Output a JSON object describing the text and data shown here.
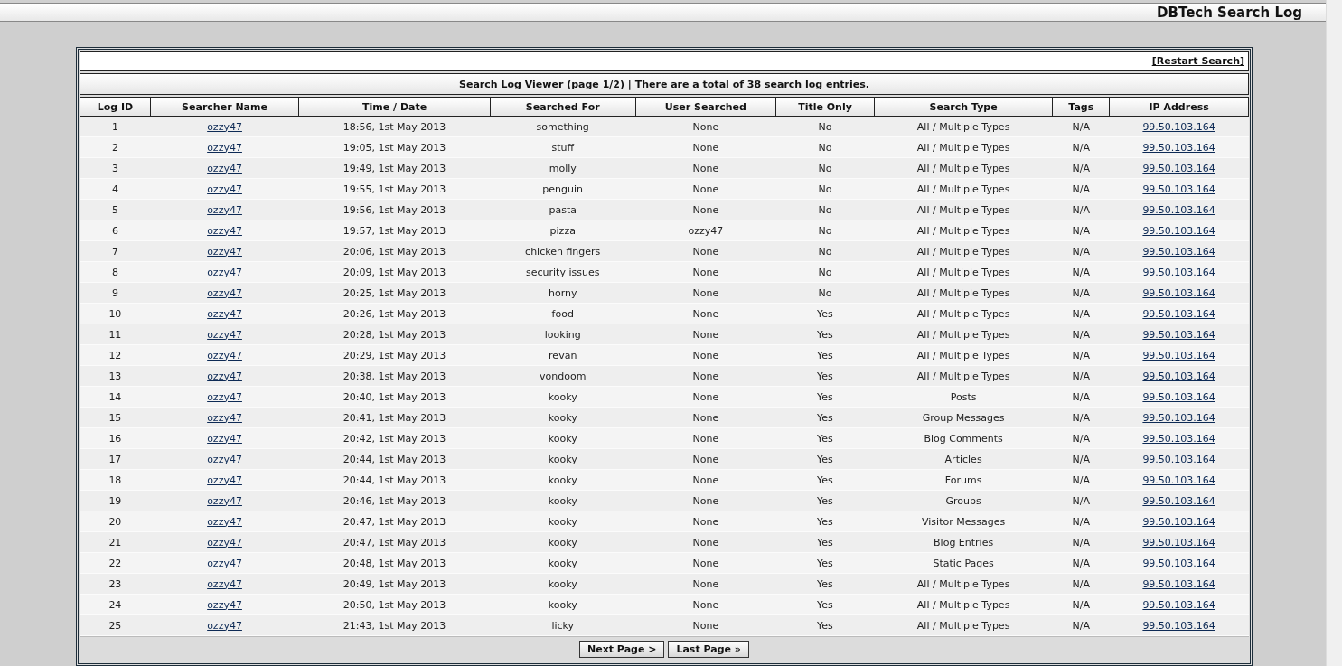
{
  "header": {
    "title": "DBTech Search Log"
  },
  "panel": {
    "restart_link": "[Restart Search]",
    "caption": "Search Log Viewer (page 1/2) | There are a total of 38 search log entries.",
    "columns": [
      {
        "label": "Log ID",
        "kind": "text"
      },
      {
        "label": "Searcher Name",
        "kind": "link"
      },
      {
        "label": "Time / Date",
        "kind": "text"
      },
      {
        "label": "Searched For",
        "kind": "text"
      },
      {
        "label": "User Searched",
        "kind": "text"
      },
      {
        "label": "Title Only",
        "kind": "text"
      },
      {
        "label": "Search Type",
        "kind": "text"
      },
      {
        "label": "Tags",
        "kind": "text"
      },
      {
        "label": "IP Address",
        "kind": "link"
      }
    ],
    "rows": [
      [
        "1",
        "ozzy47",
        "18:56, 1st May 2013",
        "something",
        "None",
        "No",
        "All / Multiple Types",
        "N/A",
        "99.50.103.164"
      ],
      [
        "2",
        "ozzy47",
        "19:05, 1st May 2013",
        "stuff",
        "None",
        "No",
        "All / Multiple Types",
        "N/A",
        "99.50.103.164"
      ],
      [
        "3",
        "ozzy47",
        "19:49, 1st May 2013",
        "molly",
        "None",
        "No",
        "All / Multiple Types",
        "N/A",
        "99.50.103.164"
      ],
      [
        "4",
        "ozzy47",
        "19:55, 1st May 2013",
        "penguin",
        "None",
        "No",
        "All / Multiple Types",
        "N/A",
        "99.50.103.164"
      ],
      [
        "5",
        "ozzy47",
        "19:56, 1st May 2013",
        "pasta",
        "None",
        "No",
        "All / Multiple Types",
        "N/A",
        "99.50.103.164"
      ],
      [
        "6",
        "ozzy47",
        "19:57, 1st May 2013",
        "pizza",
        "ozzy47",
        "No",
        "All / Multiple Types",
        "N/A",
        "99.50.103.164"
      ],
      [
        "7",
        "ozzy47",
        "20:06, 1st May 2013",
        "chicken fingers",
        "None",
        "No",
        "All / Multiple Types",
        "N/A",
        "99.50.103.164"
      ],
      [
        "8",
        "ozzy47",
        "20:09, 1st May 2013",
        "security issues",
        "None",
        "No",
        "All / Multiple Types",
        "N/A",
        "99.50.103.164"
      ],
      [
        "9",
        "ozzy47",
        "20:25, 1st May 2013",
        "horny",
        "None",
        "No",
        "All / Multiple Types",
        "N/A",
        "99.50.103.164"
      ],
      [
        "10",
        "ozzy47",
        "20:26, 1st May 2013",
        "food",
        "None",
        "Yes",
        "All / Multiple Types",
        "N/A",
        "99.50.103.164"
      ],
      [
        "11",
        "ozzy47",
        "20:28, 1st May 2013",
        "looking",
        "None",
        "Yes",
        "All / Multiple Types",
        "N/A",
        "99.50.103.164"
      ],
      [
        "12",
        "ozzy47",
        "20:29, 1st May 2013",
        "revan",
        "None",
        "Yes",
        "All / Multiple Types",
        "N/A",
        "99.50.103.164"
      ],
      [
        "13",
        "ozzy47",
        "20:38, 1st May 2013",
        "vondoom",
        "None",
        "Yes",
        "All / Multiple Types",
        "N/A",
        "99.50.103.164"
      ],
      [
        "14",
        "ozzy47",
        "20:40, 1st May 2013",
        "kooky",
        "None",
        "Yes",
        "Posts",
        "N/A",
        "99.50.103.164"
      ],
      [
        "15",
        "ozzy47",
        "20:41, 1st May 2013",
        "kooky",
        "None",
        "Yes",
        "Group Messages",
        "N/A",
        "99.50.103.164"
      ],
      [
        "16",
        "ozzy47",
        "20:42, 1st May 2013",
        "kooky",
        "None",
        "Yes",
        "Blog Comments",
        "N/A",
        "99.50.103.164"
      ],
      [
        "17",
        "ozzy47",
        "20:44, 1st May 2013",
        "kooky",
        "None",
        "Yes",
        "Articles",
        "N/A",
        "99.50.103.164"
      ],
      [
        "18",
        "ozzy47",
        "20:44, 1st May 2013",
        "kooky",
        "None",
        "Yes",
        "Forums",
        "N/A",
        "99.50.103.164"
      ],
      [
        "19",
        "ozzy47",
        "20:46, 1st May 2013",
        "kooky",
        "None",
        "Yes",
        "Groups",
        "N/A",
        "99.50.103.164"
      ],
      [
        "20",
        "ozzy47",
        "20:47, 1st May 2013",
        "kooky",
        "None",
        "Yes",
        "Visitor Messages",
        "N/A",
        "99.50.103.164"
      ],
      [
        "21",
        "ozzy47",
        "20:47, 1st May 2013",
        "kooky",
        "None",
        "Yes",
        "Blog Entries",
        "N/A",
        "99.50.103.164"
      ],
      [
        "22",
        "ozzy47",
        "20:48, 1st May 2013",
        "kooky",
        "None",
        "Yes",
        "Static Pages",
        "N/A",
        "99.50.103.164"
      ],
      [
        "23",
        "ozzy47",
        "20:49, 1st May 2013",
        "kooky",
        "None",
        "Yes",
        "All / Multiple Types",
        "N/A",
        "99.50.103.164"
      ],
      [
        "24",
        "ozzy47",
        "20:50, 1st May 2013",
        "kooky",
        "None",
        "Yes",
        "All / Multiple Types",
        "N/A",
        "99.50.103.164"
      ],
      [
        "25",
        "ozzy47",
        "21:43, 1st May 2013",
        "licky",
        "None",
        "Yes",
        "All / Multiple Types",
        "N/A",
        "99.50.103.164"
      ]
    ],
    "buttons": [
      "Next Page >",
      "Last Page »"
    ]
  }
}
